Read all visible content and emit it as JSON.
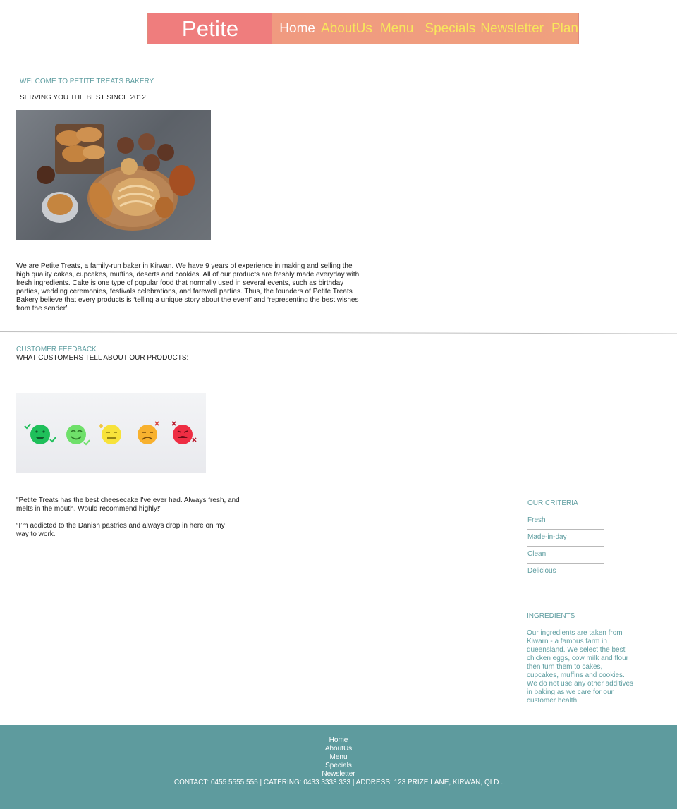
{
  "header": {
    "brand": "Petite Treats",
    "nav": [
      "Home",
      "AboutUs",
      "Menu",
      "Specials",
      "Newsletter",
      "Plan"
    ]
  },
  "welcome": {
    "title": "WELCOME TO PETITE TREATS BAKERY",
    "subtitle": "SERVING YOU THE BEST SINCE 2012",
    "intro": "We are Petite Treats, a family-run baker in Kirwan. We have 9 years of experience in making and selling the high quality cakes, cupcakes, muffins, deserts and cookies. All of our products are freshly made everyday with fresh ingredients. Cake is one type of popular food that normally used in several events, such as birthday parties, wedding ceremonies, festivals celebrations, and farewell parties. Thus, the founders of Petite Treats Bakery believe that every products is ‘telling a unique story about the event’ and ‘representing the best wishes from the sender’"
  },
  "feedback": {
    "title": "CUSTOMER FEEDBACK",
    "subtitle": "WHAT CUSTOMERS TELL ABOUT OUR PRODUCTS:",
    "reviews": [
      "\"Petite Treats has the best cheesecake I've ever had. Always fresh, and melts in the mouth. Would recommend highly!\"",
      "“I’m addicted to the Danish pastries and always drop in here on my way to work."
    ]
  },
  "criteria": {
    "title": "OUR CRITERIA",
    "items": [
      "Fresh",
      "Made-in-day",
      "Clean",
      "Delicious"
    ]
  },
  "ingredients": {
    "title": "INGREDIENTS",
    "text": "Our ingredients are taken from Kiwarn - a famous farm in queensland. We select the best chicken eggs, cow milk and flour then turn them to cakes, cupcakes, muffins and cookies. We do not use any other additives in baking as we care for our customer health."
  },
  "footer": {
    "links": [
      "Home",
      "AboutUs",
      "Menu",
      "Specials",
      "Newsletter"
    ],
    "contact": "CONTACT: 0455 5555 555 | CATERING: 0433 3333 333 | ADDRESS: 123 PRIZE LANE, KIRWAN, QLD ."
  },
  "colors": {
    "brand_bg": "#ef7d7d",
    "nav_bg": "#f09a80",
    "nav_text": "#f8e75c",
    "accent_teal": "#5e9da0",
    "footer_bg": "#5e9b9e"
  }
}
